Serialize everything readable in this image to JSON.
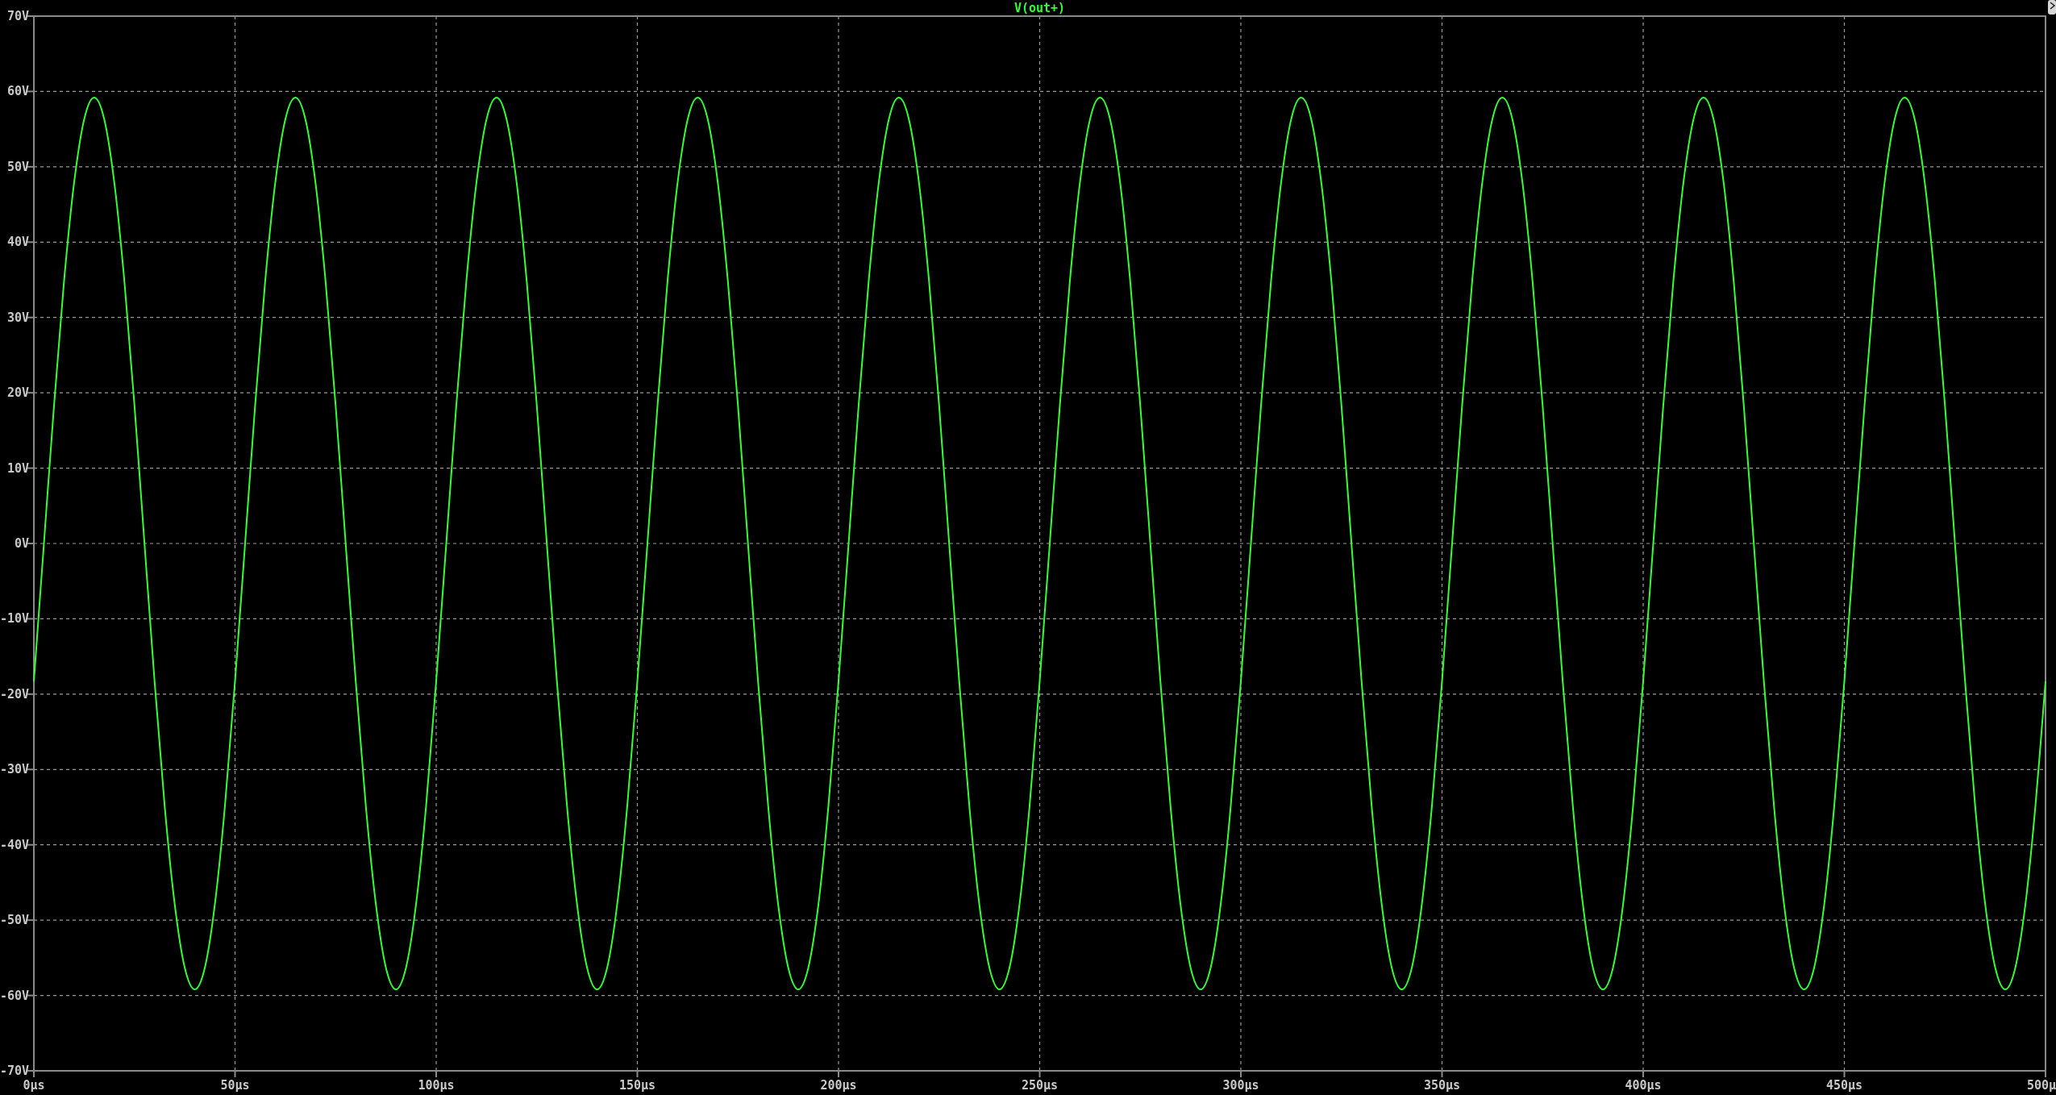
{
  "plot": {
    "chart_data": {
      "type": "line",
      "grid": true,
      "xlim": [
        0,
        500
      ],
      "ylim": [
        -70,
        70
      ],
      "xticks": [
        {
          "value": 0,
          "label": "0µs"
        },
        {
          "value": 50,
          "label": "50µs"
        },
        {
          "value": 100,
          "label": "100µs"
        },
        {
          "value": 150,
          "label": "150µs"
        },
        {
          "value": 200,
          "label": "200µs"
        },
        {
          "value": 250,
          "label": "250µs"
        },
        {
          "value": 300,
          "label": "300µs"
        },
        {
          "value": 350,
          "label": "350µs"
        },
        {
          "value": 400,
          "label": "400µs"
        },
        {
          "value": 450,
          "label": "450µs"
        },
        {
          "value": 500,
          "label": "500µ"
        }
      ],
      "yticks": [
        {
          "value": 70,
          "label": "70V"
        },
        {
          "value": 60,
          "label": "60V"
        },
        {
          "value": 50,
          "label": "50V"
        },
        {
          "value": 40,
          "label": "40V"
        },
        {
          "value": 30,
          "label": "30V"
        },
        {
          "value": 20,
          "label": "20V"
        },
        {
          "value": 10,
          "label": "10V"
        },
        {
          "value": 0,
          "label": "0V"
        },
        {
          "value": -10,
          "label": "-10V"
        },
        {
          "value": -20,
          "label": "-20V"
        },
        {
          "value": -30,
          "label": "-30V"
        },
        {
          "value": -40,
          "label": "-40V"
        },
        {
          "value": -50,
          "label": "-50V"
        },
        {
          "value": -60,
          "label": "-60V"
        },
        {
          "value": -70,
          "label": "-70V"
        }
      ],
      "x": [
        0,
        2.5,
        5,
        7.5,
        10,
        12.5,
        15,
        17.5,
        20,
        22.5,
        25,
        27.5,
        30,
        32.5,
        35,
        37.5,
        40,
        42.5,
        45,
        47.5,
        50,
        52.5,
        55,
        57.5,
        60,
        62.5,
        65,
        67.5,
        70,
        72.5,
        75,
        77.5,
        80,
        82.5,
        85,
        87.5,
        90,
        92.5,
        95,
        97.5,
        100,
        102.5,
        105,
        107.5,
        110,
        112.5,
        115,
        117.5,
        120,
        122.5,
        125,
        127.5,
        130,
        132.5,
        135,
        137.5,
        140,
        142.5,
        145,
        147.5,
        150,
        152.5,
        155,
        157.5,
        160,
        162.5,
        165,
        167.5,
        170,
        172.5,
        175,
        177.5,
        180,
        182.5,
        185,
        187.5,
        190,
        192.5,
        195,
        197.5,
        200,
        202.5,
        205,
        207.5,
        210,
        212.5,
        215,
        217.5,
        220,
        222.5,
        225,
        227.5,
        230,
        232.5,
        235,
        237.5,
        240,
        242.5,
        245,
        247.5,
        250,
        252.5,
        255,
        257.5,
        260,
        262.5,
        265,
        267.5,
        270,
        272.5,
        275,
        277.5,
        280,
        282.5,
        285,
        287.5,
        290,
        292.5,
        295,
        297.5,
        300,
        302.5,
        305,
        307.5,
        310,
        312.5,
        315,
        317.5,
        320,
        322.5,
        325,
        327.5,
        330,
        332.5,
        335,
        337.5,
        340,
        342.5,
        345,
        347.5,
        350,
        352.5,
        355,
        357.5,
        360,
        362.5,
        365,
        367.5,
        370,
        372.5,
        375,
        377.5,
        380,
        382.5,
        385,
        387.5,
        390,
        392.5,
        395,
        397.5,
        400,
        402.5,
        405,
        407.5,
        410,
        412.5,
        415,
        417.5,
        420,
        422.5,
        425,
        427.5,
        430,
        432.5,
        435,
        437.5,
        440,
        442.5,
        445,
        447.5,
        450,
        452.5,
        455,
        457.5,
        460,
        462.5,
        465,
        467.5,
        470,
        472.5,
        475,
        477.5,
        480,
        482.5,
        485,
        487.5,
        490,
        492.5,
        495,
        497.5,
        500
      ],
      "series": [
        {
          "name": "V(out+)",
          "color": "#33ff33",
          "values": [
            -18.29,
            0,
            18.29,
            34.8,
            47.89,
            56.3,
            59.2,
            56.3,
            47.89,
            34.8,
            18.29,
            0,
            -18.29,
            -34.8,
            -47.89,
            -56.3,
            -59.2,
            -56.3,
            -47.89,
            -34.8,
            -18.29,
            0,
            18.29,
            34.8,
            47.89,
            56.3,
            59.2,
            56.3,
            47.89,
            34.8,
            18.29,
            0,
            -18.29,
            -34.8,
            -47.89,
            -56.3,
            -59.2,
            -56.3,
            -47.89,
            -34.8,
            -18.29,
            0,
            18.29,
            34.8,
            47.89,
            56.3,
            59.2,
            56.3,
            47.89,
            34.8,
            18.29,
            0,
            -18.29,
            -34.8,
            -47.89,
            -56.3,
            -59.2,
            -56.3,
            -47.89,
            -34.8,
            -18.29,
            0,
            18.29,
            34.8,
            47.89,
            56.3,
            59.2,
            56.3,
            47.89,
            34.8,
            18.29,
            0,
            -18.29,
            -34.8,
            -47.89,
            -56.3,
            -59.2,
            -56.3,
            -47.89,
            -34.8,
            -18.29,
            0,
            18.29,
            34.8,
            47.89,
            56.3,
            59.2,
            56.3,
            47.89,
            34.8,
            18.29,
            0,
            -18.29,
            -34.8,
            -47.89,
            -56.3,
            -59.2,
            -56.3,
            -47.89,
            -34.8,
            -18.29,
            0,
            18.29,
            34.8,
            47.89,
            56.3,
            59.2,
            56.3,
            47.89,
            34.8,
            18.29,
            0,
            -18.29,
            -34.8,
            -47.89,
            -56.3,
            -59.2,
            -56.3,
            -47.89,
            -34.8,
            -18.29,
            0,
            18.29,
            34.8,
            47.89,
            56.3,
            59.2,
            56.3,
            47.89,
            34.8,
            18.29,
            0,
            -18.29,
            -34.8,
            -47.89,
            -56.3,
            -59.2,
            -56.3,
            -47.89,
            -34.8,
            -18.29,
            0,
            18.29,
            34.8,
            47.89,
            56.3,
            59.2,
            56.3,
            47.89,
            34.8,
            18.29,
            0,
            -18.29,
            -34.8,
            -47.89,
            -56.3,
            -59.2,
            -56.3,
            -47.89,
            -34.8,
            -18.29,
            0,
            18.29,
            34.8,
            47.89,
            56.3,
            59.2,
            56.3,
            47.89,
            34.8,
            18.29,
            0,
            -18.29,
            -34.8,
            -47.89,
            -56.3,
            -59.2,
            -56.3,
            -47.89,
            -34.8,
            -18.29,
            0,
            18.29,
            34.8,
            47.89,
            56.3,
            59.2,
            56.3,
            47.89,
            34.8,
            18.29,
            0,
            -18.29,
            -34.8,
            -47.89,
            -56.3,
            -59.2,
            -56.3,
            -47.89,
            -34.8,
            -18.29
          ]
        }
      ]
    }
  }
}
